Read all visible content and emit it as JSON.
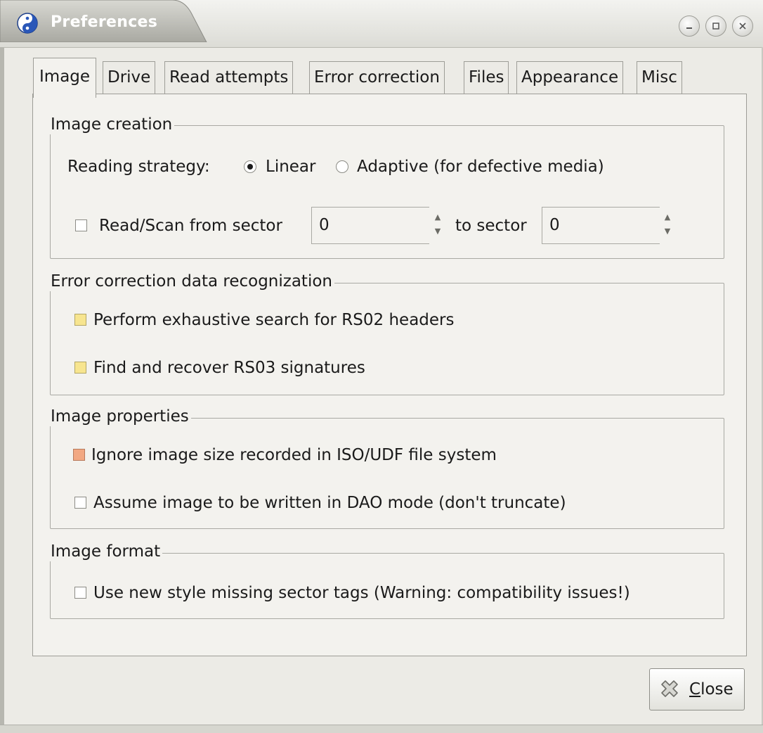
{
  "window": {
    "title": "Preferences"
  },
  "tabs": [
    {
      "label": "Image"
    },
    {
      "label": "Drive"
    },
    {
      "label": "Read attempts"
    },
    {
      "label": "Error correction"
    },
    {
      "label": "Files"
    },
    {
      "label": "Appearance"
    },
    {
      "label": "Misc"
    }
  ],
  "image_creation": {
    "title": "Image creation",
    "strategy_label": "Reading strategy:",
    "linear_label": "Linear",
    "adaptive_label": "Adaptive (for defective media)",
    "strategy_selected": "Linear",
    "range_label": "Read/Scan from sector",
    "range_checked": false,
    "from_value": "0",
    "to_label": "to sector",
    "to_value": "0"
  },
  "ecc_recognition": {
    "title": "Error correction data recognization",
    "rs02_label": "Perform exhaustive search for RS02 headers",
    "rs03_label": "Find and recover RS03 signatures"
  },
  "image_properties": {
    "title": "Image properties",
    "ignore_size_label": "Ignore image size recorded in ISO/UDF file system",
    "dao_label": "Assume image to be written in DAO mode (don't truncate)"
  },
  "image_format": {
    "title": "Image format",
    "tags_label": "Use new style missing sector tags (Warning: compatibility issues!)"
  },
  "footer": {
    "close_mnemonic": "C",
    "close_rest": "lose"
  },
  "colors": {
    "highlight_yellow": "#f7e58f",
    "highlight_orange": "#f2a882"
  }
}
